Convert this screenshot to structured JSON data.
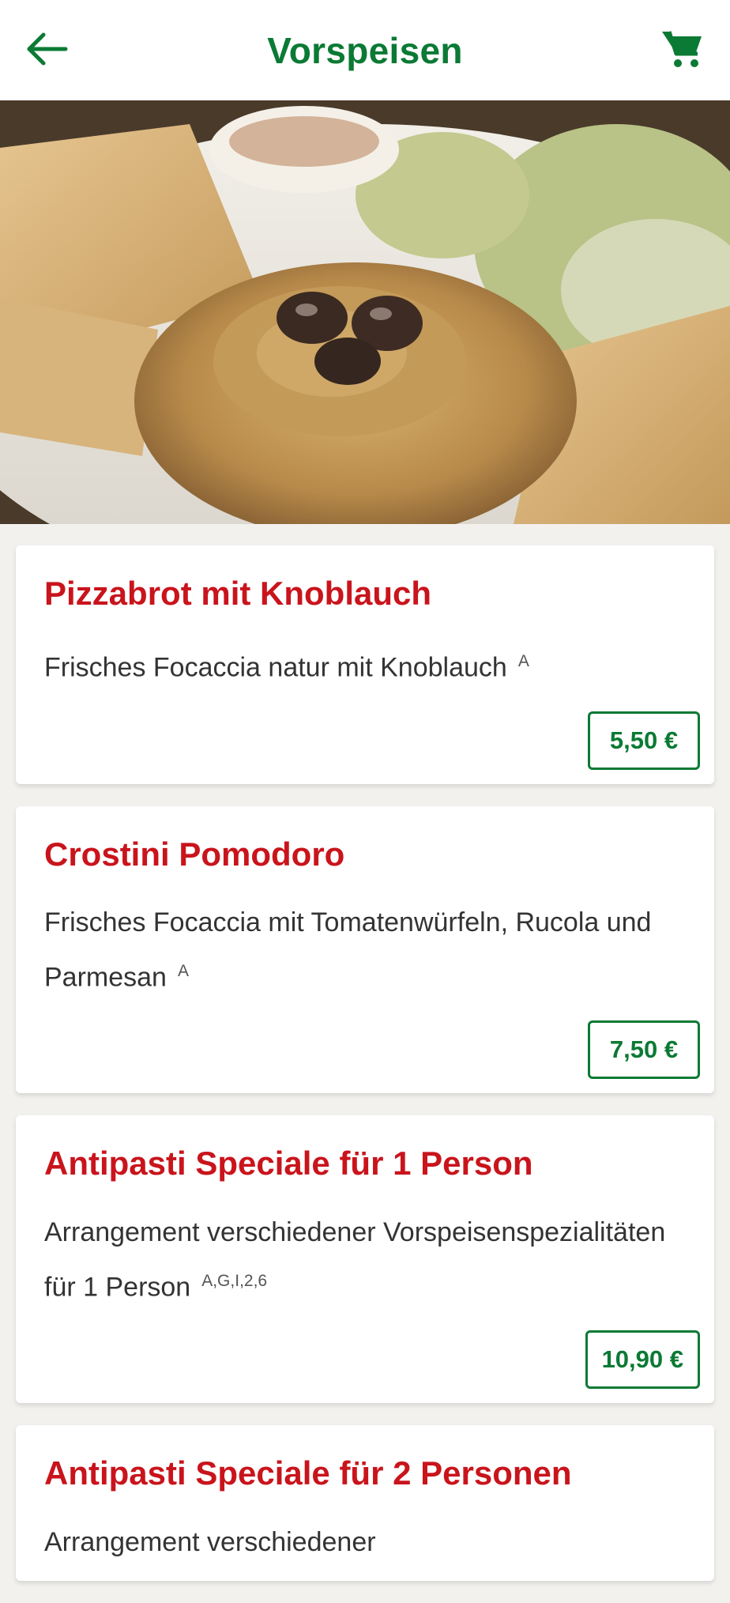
{
  "header": {
    "title": "Vorspeisen",
    "back_icon": "arrow-left-icon",
    "cart_icon": "cart-icon"
  },
  "colors": {
    "brand_green": "#0b7a34",
    "item_red": "#c9141c"
  },
  "menu_items": [
    {
      "name": "Pizzabrot mit Knoblauch",
      "description": "Frisches Focaccia natur mit Knoblauch",
      "allergens": "A",
      "price": "5,50 €"
    },
    {
      "name": "Crostini Pomodoro",
      "description": "Frisches Focaccia mit Tomatenwürfeln, Rucola und Parmesan",
      "allergens": "A",
      "price": "7,50 €"
    },
    {
      "name": "Antipasti Speciale für 1 Person",
      "description": "Arrangement verschiedener Vorspeisenspezialitäten für 1 Person",
      "allergens": "A,G,I,2,6",
      "price": "10,90 €"
    },
    {
      "name": "Antipasti Speciale für 2 Personen",
      "description": "Arrangement verschiedener",
      "allergens": "",
      "price": ""
    }
  ]
}
